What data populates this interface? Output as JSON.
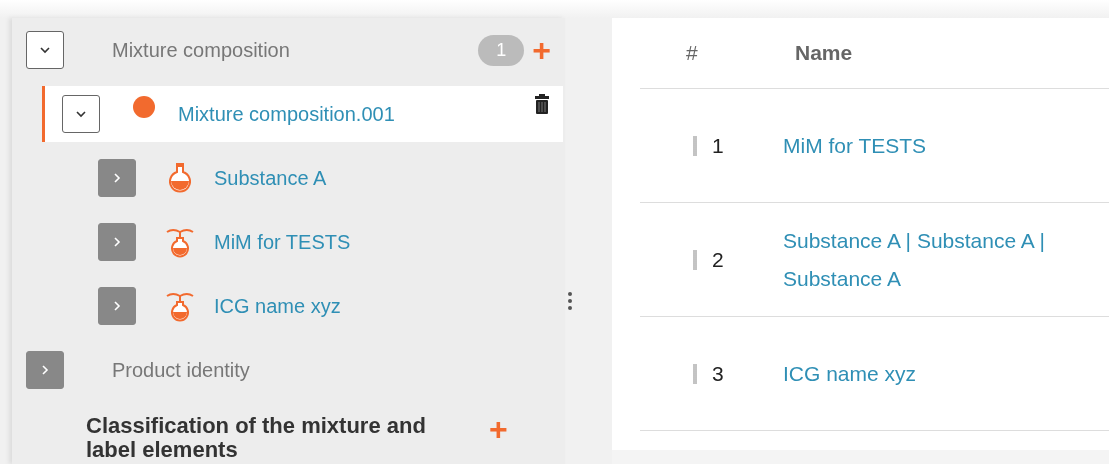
{
  "tree": [
    {
      "label": "Mixture composition",
      "kind": "group",
      "expanded": true,
      "selected": false,
      "badge": "1",
      "add": "+",
      "children": [
        {
          "label": "Mixture composition.001",
          "kind": "record",
          "expanded": true,
          "selected": true,
          "delete": true,
          "children": [
            {
              "label": "Substance A",
              "kind": "substance",
              "expanded": false,
              "selected": false
            },
            {
              "label": "MiM for TESTS",
              "kind": "mixture",
              "expanded": false,
              "selected": false
            },
            {
              "label": "ICG name xyz",
              "kind": "mixture",
              "expanded": false,
              "selected": false
            }
          ]
        }
      ]
    },
    {
      "label": "Product identity",
      "kind": "group",
      "expanded": false,
      "selected": false
    },
    {
      "label": "Classification of the mixture and label elements",
      "kind": "section",
      "selected": false,
      "add": "+"
    }
  ],
  "table": {
    "columns": [
      "#",
      "Name"
    ],
    "rows": [
      {
        "number": "1",
        "name": "MiM for TESTS"
      },
      {
        "number": "2",
        "name": "Substance A | Substance A | Substance A"
      },
      {
        "number": "3",
        "name": "ICG name xyz"
      }
    ]
  }
}
